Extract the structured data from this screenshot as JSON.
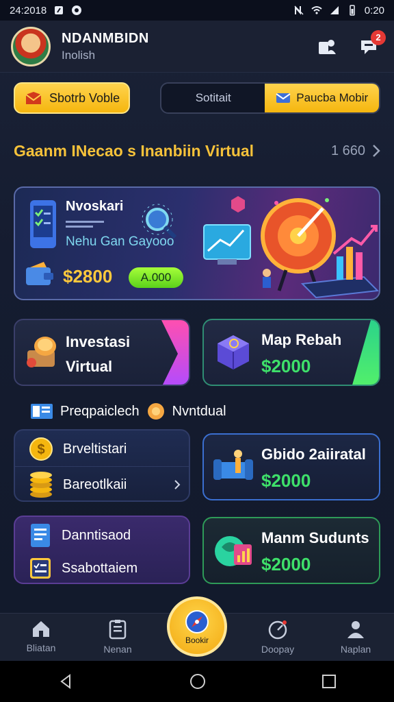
{
  "status_bar": {
    "time": "24:2018",
    "right_time": "0:20"
  },
  "header": {
    "user_name": "NDANMBIDN",
    "user_sub": "Inolish",
    "notification_count": "2"
  },
  "top_actions": {
    "primary_button": "Sbotrb Voble",
    "segments": [
      {
        "label": "Sotitait",
        "active": false
      },
      {
        "label": "Paucba Mobir",
        "active": true
      }
    ]
  },
  "section": {
    "title": "Gaanm INecao s Inanbiin Virtual",
    "count": "1 660"
  },
  "hero": {
    "title": "Nvoskari",
    "subtitle": "Nehu Gan Gayooo",
    "amount": "$2800",
    "pill": "A.000"
  },
  "cards": {
    "invest": {
      "title_line1": "Investasi",
      "title_line2": "Virtual"
    },
    "map": {
      "title": "Map Rebah",
      "amount": "$2000"
    },
    "guide": {
      "title": "Gbido 2aiiratal",
      "amount": "$2000"
    },
    "students": {
      "title": "Manm Sudunts",
      "amount": "$2000"
    }
  },
  "sub_section": {
    "label_1": "Preqpaiclech",
    "label_2": "Nvntdual"
  },
  "list_1": {
    "row_1": "Brveltistari",
    "row_2": "Bareotlkaii"
  },
  "list_2": {
    "row_1": "Danntisaod",
    "row_2": "Ssabottaiem"
  },
  "bottom_nav": {
    "items": [
      {
        "label": "Bliatan"
      },
      {
        "label": "Nenan"
      },
      {
        "label": "Bookir"
      },
      {
        "label": "Doopay"
      },
      {
        "label": "Naplan"
      }
    ]
  },
  "colors": {
    "accent": "#f6c23a",
    "money_green": "#3ee06a",
    "danger": "#e53935"
  }
}
